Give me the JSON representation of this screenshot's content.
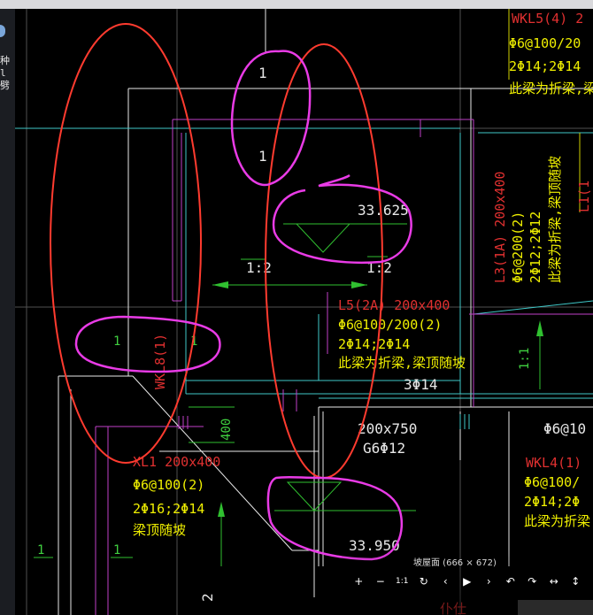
{
  "side_chars": [
    "种",
    "l",
    "劈"
  ],
  "cad_labels": {
    "wkl5_title": "WKL5(4) 2",
    "wkl5_stirrup": "Φ6@100/20",
    "wkl5_bars": "2Φ14;2Φ14",
    "wkl5_note": "此梁为折梁,梁顶",
    "l3_title": "L3(1A) 200x400",
    "l3_stirrup": "Φ6@200(2)",
    "l3_bars": "2Φ12;2Φ12",
    "l3_note": "此梁为折梁,梁顶随坡",
    "right_partial": "L1(1",
    "slope_1": "1",
    "slope_2": "1",
    "slope_3": "1:2",
    "slope_4": "1:2",
    "elev_top": "33.625",
    "l5_title": "L5(2A) 200x400",
    "l5_stirrup": "Φ6@100/200(2)",
    "l5_bars": "2Φ14;2Φ14",
    "l5_note": "此梁为折梁,梁顶随坡",
    "l5_extra": "3Φ14",
    "left_1a": "1",
    "left_1b": "1",
    "wkl8": "WKL8(1)",
    "dim_400": "400",
    "slope_11": "1:1",
    "sec_dim": "200x750",
    "sec_bars": "G6Φ12",
    "right_phi": "Φ6@10",
    "xl1_title": "XL1 200x400",
    "xl1_stirrup": "Φ6@100(2)",
    "xl1_bars": "2Φ16;2Φ14",
    "xl1_note": "梁顶随坡",
    "wkl4_title": "WKL4(1)",
    "wkl4_stirrup": "Φ6@100/",
    "wkl4_bars": "2Φ14;2Φ",
    "wkl4_note": "此梁为折梁,梁",
    "elev_bottom": "33.950",
    "bottom_1a": "1",
    "bottom_1b": "1",
    "bottom_2": "2",
    "bottom_right": "仆仕"
  },
  "viewer": {
    "image_label": "坡屋面 (666 × 672)",
    "tools": [
      {
        "name": "zoom-in-button",
        "label": "+"
      },
      {
        "name": "zoom-out-button",
        "label": "−"
      },
      {
        "name": "actual-size-button",
        "label": "1:1"
      },
      {
        "name": "reset-button",
        "label": "↻"
      },
      {
        "name": "previous-button",
        "label": "‹"
      },
      {
        "name": "play-button",
        "label": "▶"
      },
      {
        "name": "next-button",
        "label": "›"
      },
      {
        "name": "rotate-left-button",
        "label": "↶"
      },
      {
        "name": "rotate-right-button",
        "label": "↷"
      },
      {
        "name": "flip-horizontal-button",
        "label": "↔"
      },
      {
        "name": "flip-vertical-button",
        "label": "↕"
      }
    ]
  },
  "colors": {
    "background": "#000000",
    "annotation_red": "#ff3b2f",
    "annotation_magenta": "#e93be6",
    "beam_white": "#e8e8e8",
    "beam_cyan": "#3fc8c8",
    "beam_magenta": "#c040c8",
    "text_yellow": "#f0f000",
    "text_red": "#e03030",
    "dim_green": "#30c030"
  }
}
